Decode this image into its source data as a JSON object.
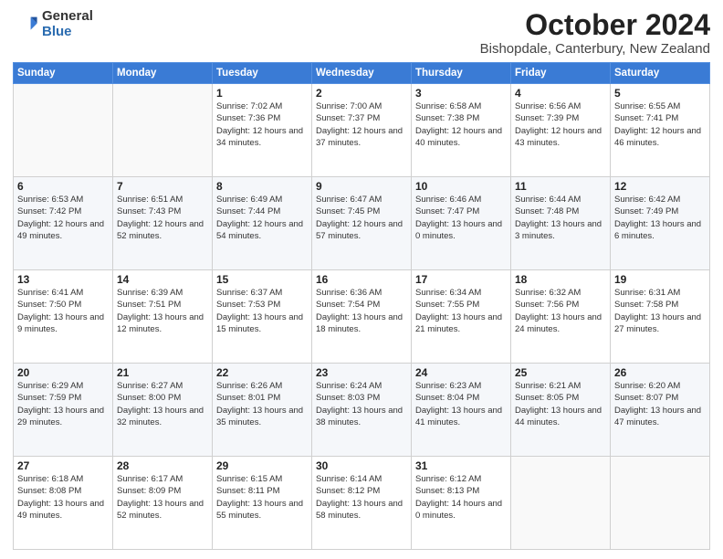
{
  "logo": {
    "general": "General",
    "blue": "Blue"
  },
  "header": {
    "month": "October 2024",
    "location": "Bishopdale, Canterbury, New Zealand"
  },
  "days": [
    "Sunday",
    "Monday",
    "Tuesday",
    "Wednesday",
    "Thursday",
    "Friday",
    "Saturday"
  ],
  "weeks": [
    [
      {
        "day": "",
        "content": ""
      },
      {
        "day": "",
        "content": ""
      },
      {
        "day": "1",
        "content": "Sunrise: 7:02 AM\nSunset: 7:36 PM\nDaylight: 12 hours and 34 minutes."
      },
      {
        "day": "2",
        "content": "Sunrise: 7:00 AM\nSunset: 7:37 PM\nDaylight: 12 hours and 37 minutes."
      },
      {
        "day": "3",
        "content": "Sunrise: 6:58 AM\nSunset: 7:38 PM\nDaylight: 12 hours and 40 minutes."
      },
      {
        "day": "4",
        "content": "Sunrise: 6:56 AM\nSunset: 7:39 PM\nDaylight: 12 hours and 43 minutes."
      },
      {
        "day": "5",
        "content": "Sunrise: 6:55 AM\nSunset: 7:41 PM\nDaylight: 12 hours and 46 minutes."
      }
    ],
    [
      {
        "day": "6",
        "content": "Sunrise: 6:53 AM\nSunset: 7:42 PM\nDaylight: 12 hours and 49 minutes."
      },
      {
        "day": "7",
        "content": "Sunrise: 6:51 AM\nSunset: 7:43 PM\nDaylight: 12 hours and 52 minutes."
      },
      {
        "day": "8",
        "content": "Sunrise: 6:49 AM\nSunset: 7:44 PM\nDaylight: 12 hours and 54 minutes."
      },
      {
        "day": "9",
        "content": "Sunrise: 6:47 AM\nSunset: 7:45 PM\nDaylight: 12 hours and 57 minutes."
      },
      {
        "day": "10",
        "content": "Sunrise: 6:46 AM\nSunset: 7:47 PM\nDaylight: 13 hours and 0 minutes."
      },
      {
        "day": "11",
        "content": "Sunrise: 6:44 AM\nSunset: 7:48 PM\nDaylight: 13 hours and 3 minutes."
      },
      {
        "day": "12",
        "content": "Sunrise: 6:42 AM\nSunset: 7:49 PM\nDaylight: 13 hours and 6 minutes."
      }
    ],
    [
      {
        "day": "13",
        "content": "Sunrise: 6:41 AM\nSunset: 7:50 PM\nDaylight: 13 hours and 9 minutes."
      },
      {
        "day": "14",
        "content": "Sunrise: 6:39 AM\nSunset: 7:51 PM\nDaylight: 13 hours and 12 minutes."
      },
      {
        "day": "15",
        "content": "Sunrise: 6:37 AM\nSunset: 7:53 PM\nDaylight: 13 hours and 15 minutes."
      },
      {
        "day": "16",
        "content": "Sunrise: 6:36 AM\nSunset: 7:54 PM\nDaylight: 13 hours and 18 minutes."
      },
      {
        "day": "17",
        "content": "Sunrise: 6:34 AM\nSunset: 7:55 PM\nDaylight: 13 hours and 21 minutes."
      },
      {
        "day": "18",
        "content": "Sunrise: 6:32 AM\nSunset: 7:56 PM\nDaylight: 13 hours and 24 minutes."
      },
      {
        "day": "19",
        "content": "Sunrise: 6:31 AM\nSunset: 7:58 PM\nDaylight: 13 hours and 27 minutes."
      }
    ],
    [
      {
        "day": "20",
        "content": "Sunrise: 6:29 AM\nSunset: 7:59 PM\nDaylight: 13 hours and 29 minutes."
      },
      {
        "day": "21",
        "content": "Sunrise: 6:27 AM\nSunset: 8:00 PM\nDaylight: 13 hours and 32 minutes."
      },
      {
        "day": "22",
        "content": "Sunrise: 6:26 AM\nSunset: 8:01 PM\nDaylight: 13 hours and 35 minutes."
      },
      {
        "day": "23",
        "content": "Sunrise: 6:24 AM\nSunset: 8:03 PM\nDaylight: 13 hours and 38 minutes."
      },
      {
        "day": "24",
        "content": "Sunrise: 6:23 AM\nSunset: 8:04 PM\nDaylight: 13 hours and 41 minutes."
      },
      {
        "day": "25",
        "content": "Sunrise: 6:21 AM\nSunset: 8:05 PM\nDaylight: 13 hours and 44 minutes."
      },
      {
        "day": "26",
        "content": "Sunrise: 6:20 AM\nSunset: 8:07 PM\nDaylight: 13 hours and 47 minutes."
      }
    ],
    [
      {
        "day": "27",
        "content": "Sunrise: 6:18 AM\nSunset: 8:08 PM\nDaylight: 13 hours and 49 minutes."
      },
      {
        "day": "28",
        "content": "Sunrise: 6:17 AM\nSunset: 8:09 PM\nDaylight: 13 hours and 52 minutes."
      },
      {
        "day": "29",
        "content": "Sunrise: 6:15 AM\nSunset: 8:11 PM\nDaylight: 13 hours and 55 minutes."
      },
      {
        "day": "30",
        "content": "Sunrise: 6:14 AM\nSunset: 8:12 PM\nDaylight: 13 hours and 58 minutes."
      },
      {
        "day": "31",
        "content": "Sunrise: 6:12 AM\nSunset: 8:13 PM\nDaylight: 14 hours and 0 minutes."
      },
      {
        "day": "",
        "content": ""
      },
      {
        "day": "",
        "content": ""
      }
    ]
  ]
}
